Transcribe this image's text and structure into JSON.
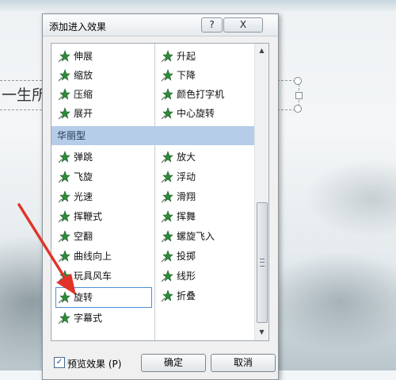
{
  "dialog": {
    "title": "添加进入效果",
    "help_label": "?",
    "close_label": "X"
  },
  "list": {
    "left_top": [
      {
        "label": "伸展",
        "icon": "star-effect-icon"
      },
      {
        "label": "缩放",
        "icon": "star-effect-icon"
      },
      {
        "label": "压缩",
        "icon": "star-effect-icon"
      },
      {
        "label": "展开",
        "icon": "star-effect-icon"
      }
    ],
    "right_top": [
      {
        "label": "升起",
        "icon": "star-effect-icon"
      },
      {
        "label": "下降",
        "icon": "star-effect-icon"
      },
      {
        "label": "颜色打字机",
        "icon": "star-effect-icon"
      },
      {
        "label": "中心旋转",
        "icon": "star-effect-icon"
      }
    ],
    "group_header": "华丽型",
    "left_group": [
      {
        "label": "弹跳"
      },
      {
        "label": "飞旋"
      },
      {
        "label": "光速"
      },
      {
        "label": "挥鞭式"
      },
      {
        "label": "空翻"
      },
      {
        "label": "曲线向上"
      },
      {
        "label": "玩具风车"
      },
      {
        "label": "旋转"
      },
      {
        "label": "字幕式"
      }
    ],
    "right_group": [
      {
        "label": "放大"
      },
      {
        "label": "浮动"
      },
      {
        "label": "滑翔"
      },
      {
        "label": "挥舞"
      },
      {
        "label": "螺旋飞入"
      },
      {
        "label": "投掷"
      },
      {
        "label": "线形"
      },
      {
        "label": "折叠"
      }
    ],
    "selected_item": "旋转"
  },
  "footer": {
    "preview_label": "预览效果 (P)",
    "preview_checked": true,
    "ok_label": "确定",
    "cancel_label": "取消"
  },
  "slide": {
    "placeholder_text": "一生所"
  },
  "colors": {
    "icon_green": "#2e8b3a",
    "group_header_bg": "#b5cde8",
    "selection_border": "#4b8fd6",
    "annotation_arrow": "#e0342a"
  }
}
